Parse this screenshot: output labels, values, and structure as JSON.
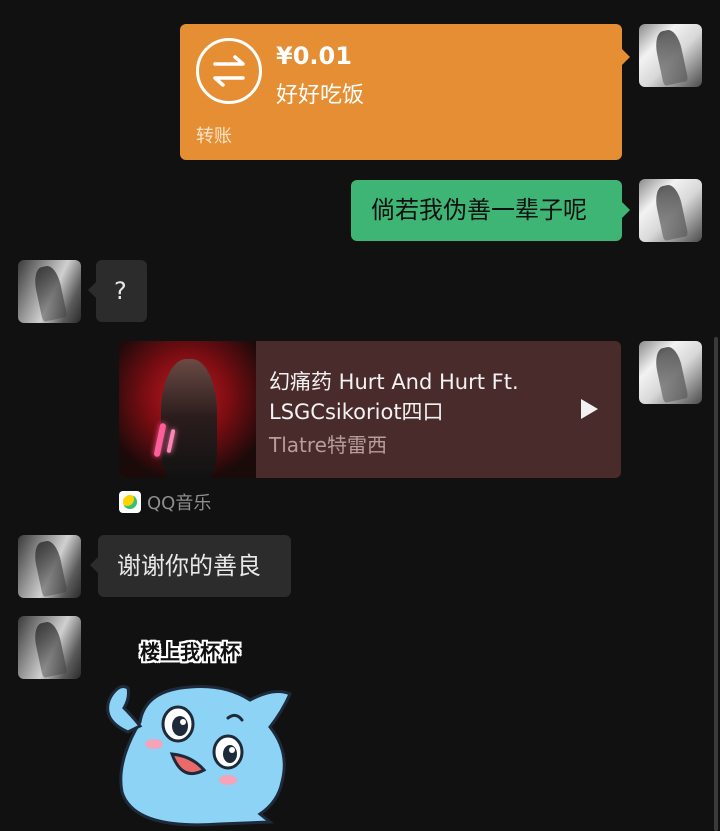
{
  "messages": {
    "transfer": {
      "amount": "¥0.01",
      "note": "好好吃饭",
      "label": "转账",
      "icon": "transfer-arrows-icon",
      "color": "#E58E33"
    },
    "text_sent": "倘若我伪善一辈子呢",
    "text_received_1": "?",
    "music": {
      "title": "幻痛药 Hurt And Hurt Ft. LSGCsikoriot四口",
      "artist": "Tlatre特雷西",
      "source": "QQ音乐",
      "play_icon": "play-icon",
      "color": "#4A2B2C"
    },
    "text_received_2": "谢谢你的善良",
    "sticker": {
      "caption": "楼上我杯杯",
      "icon": "blue-mascot-sticker"
    }
  },
  "colors": {
    "background": "#111111",
    "sent_bubble": "#3EB575",
    "received_bubble": "#2C2C2C"
  }
}
